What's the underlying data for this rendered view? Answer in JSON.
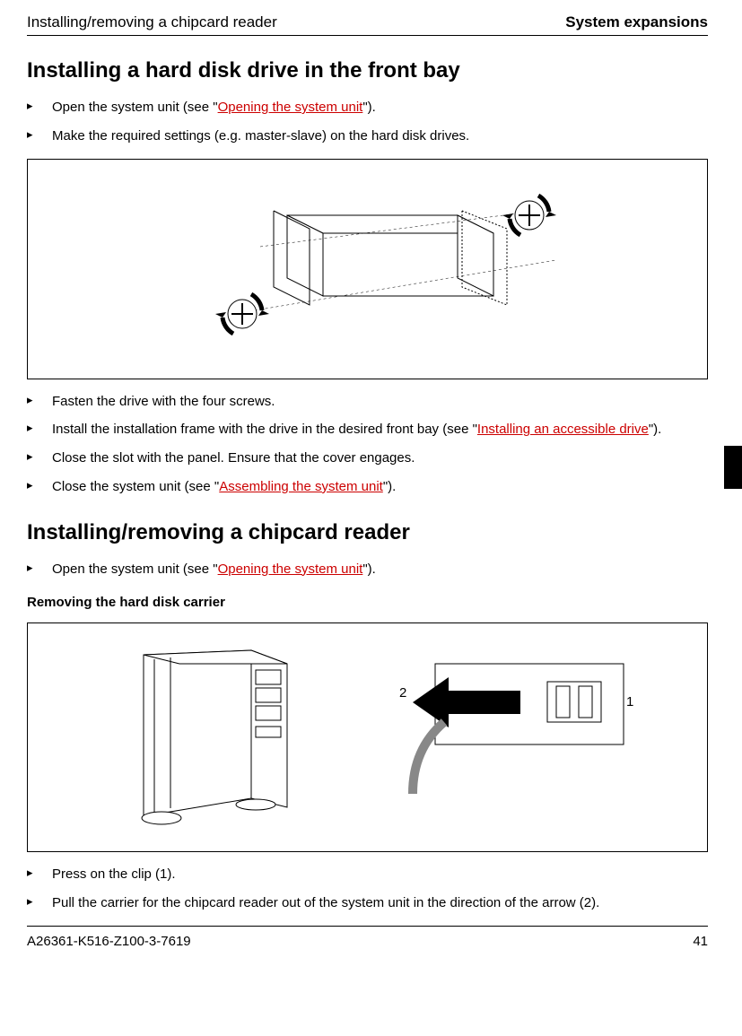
{
  "header": {
    "left": "Installing/removing a chipcard reader",
    "right": "System expansions"
  },
  "section1": {
    "title": "Installing a hard disk drive in the front bay",
    "steps_a": [
      {
        "pre": "Open the system unit (see \"",
        "link": "Opening the system unit",
        "post": "\")."
      },
      {
        "pre": "Make the required settings (e.g. master-slave) on the hard disk drives.",
        "link": "",
        "post": ""
      }
    ],
    "steps_b": [
      {
        "pre": "Fasten the drive with the four screws.",
        "link": "",
        "post": ""
      },
      {
        "pre": "Install the installation frame with the drive in the desired front bay (see \"",
        "link": "Installing an accessible drive",
        "post": "\")."
      },
      {
        "pre": "Close the slot with the panel. Ensure that the cover engages.",
        "link": "",
        "post": ""
      },
      {
        "pre": "Close the system unit (see \"",
        "link": "Assembling the system unit",
        "post": "\")."
      }
    ]
  },
  "section2": {
    "title": "Installing/removing a chipcard reader",
    "steps_a": [
      {
        "pre": "Open the system unit (see \"",
        "link": "Opening the system unit",
        "post": "\")."
      }
    ],
    "subhead": "Removing the hard disk carrier",
    "fig2_labels": {
      "left": "2",
      "right": "1"
    },
    "steps_b": [
      {
        "pre": "Press on the clip (1).",
        "link": "",
        "post": ""
      },
      {
        "pre": "Pull the carrier for the chipcard reader out of the system unit in the direction of the arrow  (2).",
        "link": "",
        "post": ""
      }
    ]
  },
  "footer": {
    "left": "A26361-K516-Z100-3-7619",
    "right": "41"
  }
}
